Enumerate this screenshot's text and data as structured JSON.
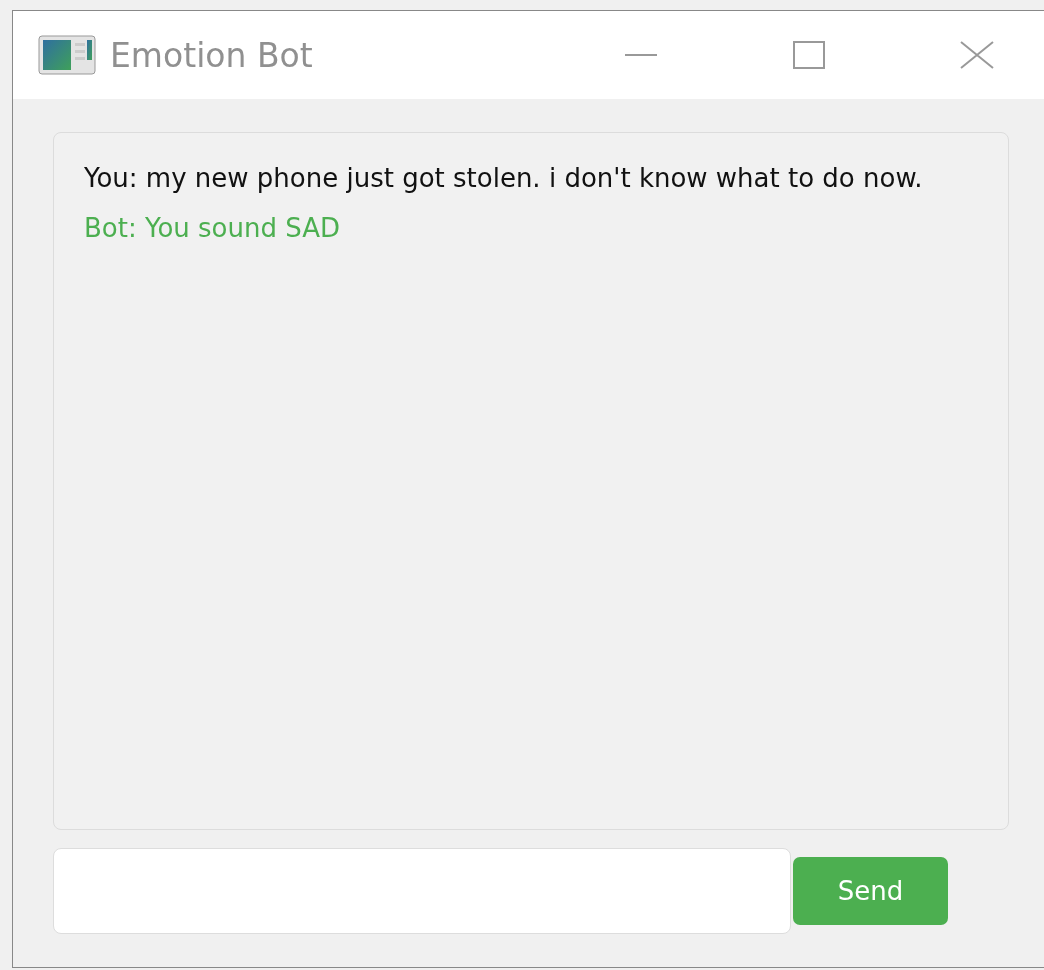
{
  "window": {
    "title": "Emotion Bot"
  },
  "messages": [
    {
      "kind": "user",
      "text": "You: my new phone just got stolen. i don't know what to do now."
    },
    {
      "kind": "bot",
      "text": "Bot: You sound SAD"
    }
  ],
  "send_button": {
    "label": "Send"
  }
}
